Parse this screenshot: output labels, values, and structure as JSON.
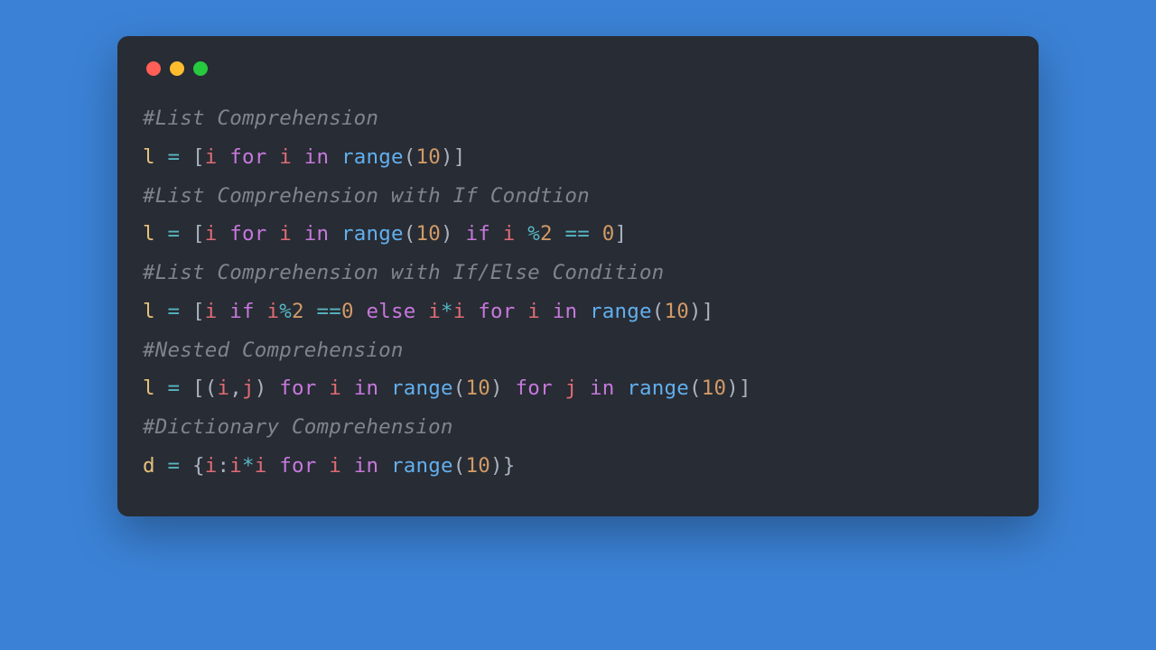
{
  "colors": {
    "background": "#3b82d6",
    "window": "#282c34",
    "traffic_red": "#ff5f56",
    "traffic_yellow": "#ffbd2e",
    "traffic_green": "#27c93f",
    "comment": "#7f848e",
    "variable": "#e5c07b",
    "operator": "#56b6c2",
    "punctuation": "#abb2bf",
    "keyword": "#c678dd",
    "function": "#61afef",
    "number": "#d19a66",
    "identifier": "#e06c75"
  },
  "lines": [
    {
      "type": "comment",
      "text": "#List Comprehension"
    },
    {
      "type": "code",
      "tokens": [
        {
          "t": "l",
          "c": "var"
        },
        {
          "t": " ",
          "c": "plain"
        },
        {
          "t": "=",
          "c": "op"
        },
        {
          "t": " ",
          "c": "plain"
        },
        {
          "t": "[",
          "c": "punct"
        },
        {
          "t": "i",
          "c": "ident"
        },
        {
          "t": " ",
          "c": "plain"
        },
        {
          "t": "for",
          "c": "kw"
        },
        {
          "t": " ",
          "c": "plain"
        },
        {
          "t": "i",
          "c": "ident"
        },
        {
          "t": " ",
          "c": "plain"
        },
        {
          "t": "in",
          "c": "kw"
        },
        {
          "t": " ",
          "c": "plain"
        },
        {
          "t": "range",
          "c": "func"
        },
        {
          "t": "(",
          "c": "punct"
        },
        {
          "t": "10",
          "c": "num"
        },
        {
          "t": ")",
          "c": "punct"
        },
        {
          "t": "]",
          "c": "punct"
        }
      ]
    },
    {
      "type": "comment",
      "text": "#List Comprehension with If Condtion"
    },
    {
      "type": "code",
      "tokens": [
        {
          "t": "l",
          "c": "var"
        },
        {
          "t": " ",
          "c": "plain"
        },
        {
          "t": "=",
          "c": "op"
        },
        {
          "t": " ",
          "c": "plain"
        },
        {
          "t": "[",
          "c": "punct"
        },
        {
          "t": "i",
          "c": "ident"
        },
        {
          "t": " ",
          "c": "plain"
        },
        {
          "t": "for",
          "c": "kw"
        },
        {
          "t": " ",
          "c": "plain"
        },
        {
          "t": "i",
          "c": "ident"
        },
        {
          "t": " ",
          "c": "plain"
        },
        {
          "t": "in",
          "c": "kw"
        },
        {
          "t": " ",
          "c": "plain"
        },
        {
          "t": "range",
          "c": "func"
        },
        {
          "t": "(",
          "c": "punct"
        },
        {
          "t": "10",
          "c": "num"
        },
        {
          "t": ")",
          "c": "punct"
        },
        {
          "t": " ",
          "c": "plain"
        },
        {
          "t": "if",
          "c": "kw"
        },
        {
          "t": " ",
          "c": "plain"
        },
        {
          "t": "i",
          "c": "ident"
        },
        {
          "t": " ",
          "c": "plain"
        },
        {
          "t": "%",
          "c": "op"
        },
        {
          "t": "2",
          "c": "num"
        },
        {
          "t": " ",
          "c": "plain"
        },
        {
          "t": "==",
          "c": "op"
        },
        {
          "t": " ",
          "c": "plain"
        },
        {
          "t": "0",
          "c": "num"
        },
        {
          "t": "]",
          "c": "punct"
        }
      ]
    },
    {
      "type": "comment",
      "text": "#List Comprehension with If/Else Condition"
    },
    {
      "type": "code",
      "tokens": [
        {
          "t": "l",
          "c": "var"
        },
        {
          "t": " ",
          "c": "plain"
        },
        {
          "t": "=",
          "c": "op"
        },
        {
          "t": " ",
          "c": "plain"
        },
        {
          "t": "[",
          "c": "punct"
        },
        {
          "t": "i",
          "c": "ident"
        },
        {
          "t": " ",
          "c": "plain"
        },
        {
          "t": "if",
          "c": "kw"
        },
        {
          "t": " ",
          "c": "plain"
        },
        {
          "t": "i",
          "c": "ident"
        },
        {
          "t": "%",
          "c": "op"
        },
        {
          "t": "2",
          "c": "num"
        },
        {
          "t": " ",
          "c": "plain"
        },
        {
          "t": "==",
          "c": "op"
        },
        {
          "t": "0",
          "c": "num"
        },
        {
          "t": " ",
          "c": "plain"
        },
        {
          "t": "else",
          "c": "kw"
        },
        {
          "t": " ",
          "c": "plain"
        },
        {
          "t": "i",
          "c": "ident"
        },
        {
          "t": "*",
          "c": "op"
        },
        {
          "t": "i",
          "c": "ident"
        },
        {
          "t": " ",
          "c": "plain"
        },
        {
          "t": "for",
          "c": "kw"
        },
        {
          "t": " ",
          "c": "plain"
        },
        {
          "t": "i",
          "c": "ident"
        },
        {
          "t": " ",
          "c": "plain"
        },
        {
          "t": "in",
          "c": "kw"
        },
        {
          "t": " ",
          "c": "plain"
        },
        {
          "t": "range",
          "c": "func"
        },
        {
          "t": "(",
          "c": "punct"
        },
        {
          "t": "10",
          "c": "num"
        },
        {
          "t": ")",
          "c": "punct"
        },
        {
          "t": "]",
          "c": "punct"
        }
      ]
    },
    {
      "type": "comment",
      "text": "#Nested Comprehension"
    },
    {
      "type": "code",
      "tokens": [
        {
          "t": "l",
          "c": "var"
        },
        {
          "t": " ",
          "c": "plain"
        },
        {
          "t": "=",
          "c": "op"
        },
        {
          "t": " ",
          "c": "plain"
        },
        {
          "t": "[",
          "c": "punct"
        },
        {
          "t": "(",
          "c": "punct"
        },
        {
          "t": "i",
          "c": "ident"
        },
        {
          "t": ",",
          "c": "punct"
        },
        {
          "t": "j",
          "c": "ident"
        },
        {
          "t": ")",
          "c": "punct"
        },
        {
          "t": " ",
          "c": "plain"
        },
        {
          "t": "for",
          "c": "kw"
        },
        {
          "t": " ",
          "c": "plain"
        },
        {
          "t": "i",
          "c": "ident"
        },
        {
          "t": " ",
          "c": "plain"
        },
        {
          "t": "in",
          "c": "kw"
        },
        {
          "t": " ",
          "c": "plain"
        },
        {
          "t": "range",
          "c": "func"
        },
        {
          "t": "(",
          "c": "punct"
        },
        {
          "t": "10",
          "c": "num"
        },
        {
          "t": ")",
          "c": "punct"
        },
        {
          "t": " ",
          "c": "plain"
        },
        {
          "t": "for",
          "c": "kw"
        },
        {
          "t": " ",
          "c": "plain"
        },
        {
          "t": "j",
          "c": "ident"
        },
        {
          "t": " ",
          "c": "plain"
        },
        {
          "t": "in",
          "c": "kw"
        },
        {
          "t": " ",
          "c": "plain"
        },
        {
          "t": "range",
          "c": "func"
        },
        {
          "t": "(",
          "c": "punct"
        },
        {
          "t": "10",
          "c": "num"
        },
        {
          "t": ")",
          "c": "punct"
        },
        {
          "t": "]",
          "c": "punct"
        }
      ]
    },
    {
      "type": "comment",
      "text": "#Dictionary Comprehension"
    },
    {
      "type": "code",
      "tokens": [
        {
          "t": "d",
          "c": "var"
        },
        {
          "t": " ",
          "c": "plain"
        },
        {
          "t": "=",
          "c": "op"
        },
        {
          "t": " ",
          "c": "plain"
        },
        {
          "t": "{",
          "c": "punct"
        },
        {
          "t": "i",
          "c": "ident"
        },
        {
          "t": ":",
          "c": "punct"
        },
        {
          "t": "i",
          "c": "ident"
        },
        {
          "t": "*",
          "c": "op"
        },
        {
          "t": "i",
          "c": "ident"
        },
        {
          "t": " ",
          "c": "plain"
        },
        {
          "t": "for",
          "c": "kw"
        },
        {
          "t": " ",
          "c": "plain"
        },
        {
          "t": "i",
          "c": "ident"
        },
        {
          "t": " ",
          "c": "plain"
        },
        {
          "t": "in",
          "c": "kw"
        },
        {
          "t": " ",
          "c": "plain"
        },
        {
          "t": "range",
          "c": "func"
        },
        {
          "t": "(",
          "c": "punct"
        },
        {
          "t": "10",
          "c": "num"
        },
        {
          "t": ")",
          "c": "punct"
        },
        {
          "t": "}",
          "c": "punct"
        }
      ]
    }
  ]
}
